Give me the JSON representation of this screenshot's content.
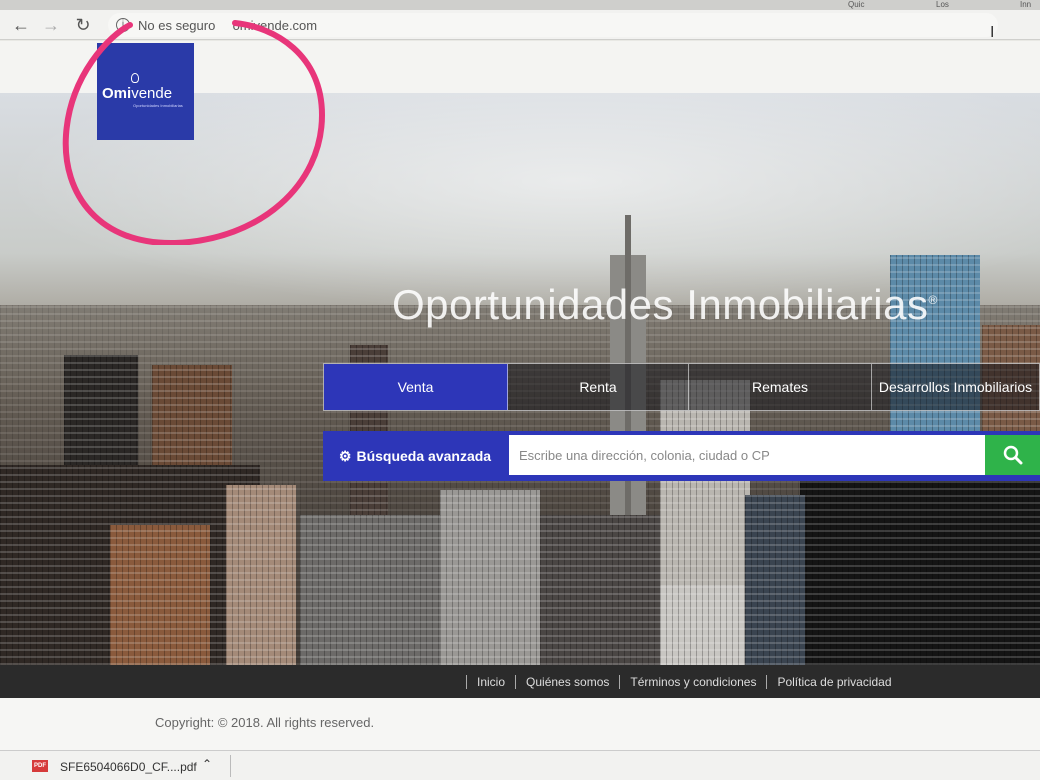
{
  "browser": {
    "security_label": "No es seguro",
    "url": "omivende.com",
    "tab_fragments": [
      "Quic",
      "Los",
      "Inn"
    ]
  },
  "brand": {
    "name_bold": "Omi",
    "name_light": "vende",
    "tagline": "Oportunidades Inmobiliarias",
    "bg_color": "#2a3aa8"
  },
  "hero": {
    "title": "Oportunidades Inmobiliarias",
    "reg_mark": "®"
  },
  "tabs": [
    {
      "label": "Venta",
      "active": true
    },
    {
      "label": "Renta",
      "active": false
    },
    {
      "label": "Remates",
      "active": false
    },
    {
      "label": "Desarrollos Inmobiliarios",
      "active": false
    }
  ],
  "search": {
    "advanced_label": "Búsqueda avanzada",
    "placeholder": "Escribe una dirección, colonia, ciudad o CP",
    "button_icon": "search-icon",
    "button_color": "#2fb34a",
    "accent_color": "#2d36b8"
  },
  "footer": {
    "links": [
      "Inicio",
      "Quiénes somos",
      "Términos y condiciones",
      "Política de privacidad"
    ],
    "copyright": "Copyright: © 2018. All rights reserved."
  },
  "download": {
    "icon_label": "PDF",
    "filename": "SFE6504066D0_CF....pdf"
  },
  "annotation": {
    "shape": "hand-drawn-circle",
    "color": "#e8357a"
  }
}
